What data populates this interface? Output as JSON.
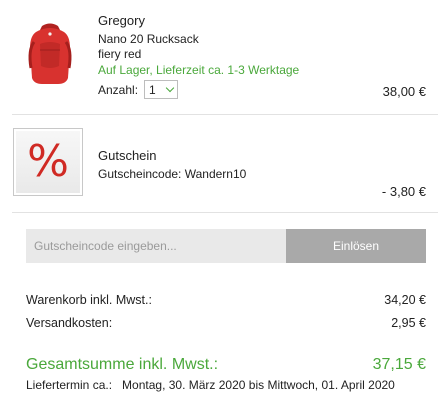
{
  "items": [
    {
      "brand": "Gregory",
      "name": "Nano 20 Rucksack",
      "color": "fiery red",
      "stock": "Auf Lager, Lieferzeit ca. 1-3 Werktage",
      "qty_label": "Anzahl:",
      "qty_value": "1",
      "price": "38,00 €"
    },
    {
      "name": "Gutschein",
      "code_line": "Gutscheincode: Wandern10",
      "symbol": "%",
      "price": "- 3,80 €"
    }
  ],
  "coupon": {
    "placeholder": "Gutscheincode eingeben...",
    "button_label": "Einlösen"
  },
  "summary": {
    "subtotal_label": "Warenkorb inkl. Mwst.:",
    "subtotal_value": "34,20 €",
    "shipping_label": "Versandkosten:",
    "shipping_value": "2,95 €",
    "total_label": "Gesamtsumme inkl. Mwst.:",
    "total_value": "37,15 €",
    "delivery_label": "Liefertermin ca.:",
    "delivery_value": "Montag, 30. März 2020 bis Mittwoch, 01. April 2020"
  },
  "colors": {
    "accent_green": "#4aa83b",
    "voucher_red": "#d02a24",
    "bag_red": "#d8322f",
    "button_grey": "#a9a9a9"
  }
}
